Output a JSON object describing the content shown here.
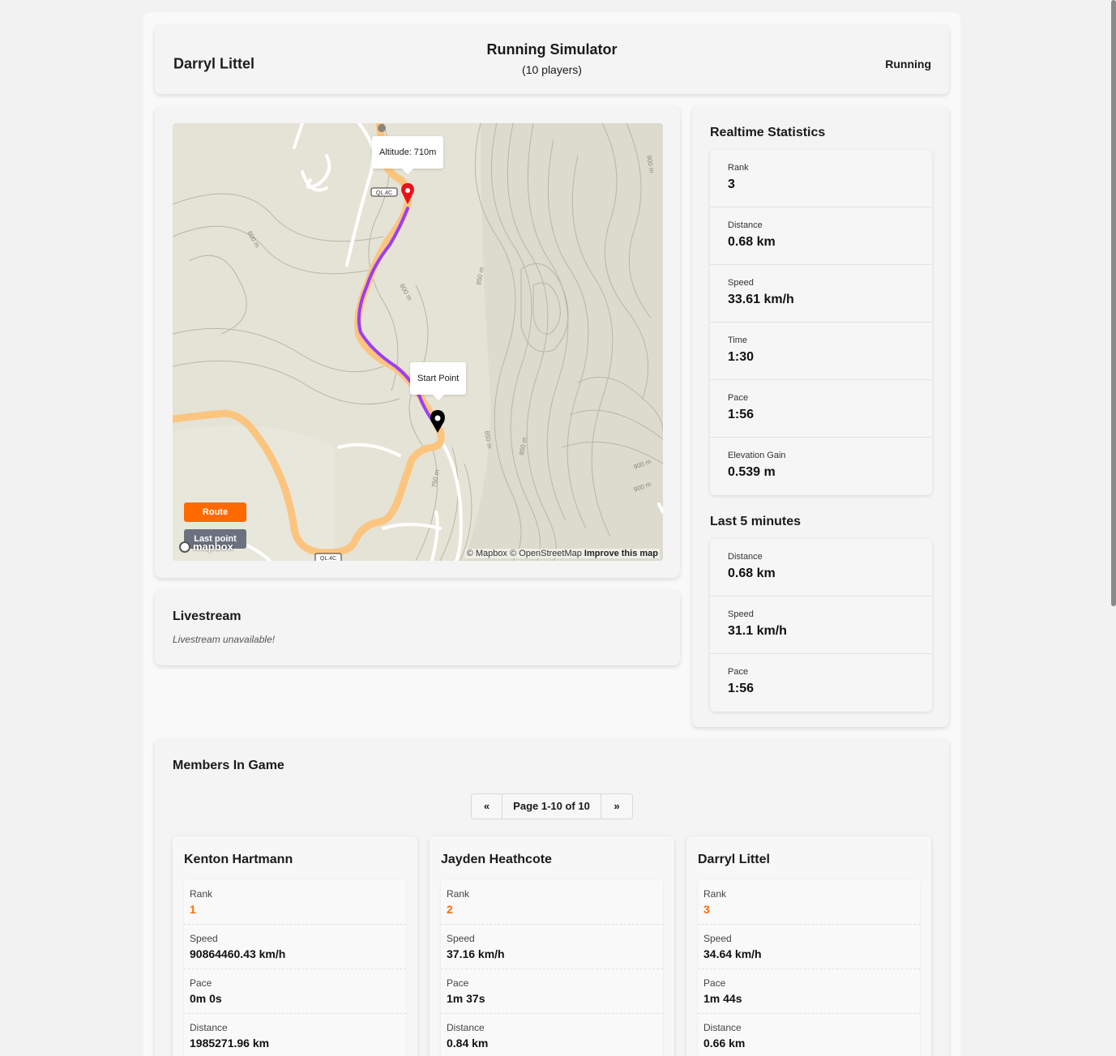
{
  "header": {
    "player_name": "Darryl Littel",
    "title": "Running Simulator",
    "subtitle": "(10 players)",
    "status": "Running"
  },
  "map": {
    "popup_altitude": "Altitude: 710m",
    "popup_start": "Start Point",
    "route_button": "Route",
    "last_point_button": "Last point",
    "logo_text": "mapbox",
    "attribution": "© Mapbox © OpenStreetMap",
    "improve_link": "Improve this map",
    "road_label": "QL.4C",
    "contour_labels": [
      "800 m",
      "900 m",
      "850 m",
      "800 m",
      "850 m",
      "850 m",
      "900 m",
      "750 m",
      "900 m"
    ],
    "colors": {
      "route": "#9b3ff2",
      "road": "#fbc57f",
      "marker_end": "#e8121b",
      "marker_start": "#000000"
    }
  },
  "livestream": {
    "title": "Livestream",
    "message": "Livestream unavailable!"
  },
  "realtime": {
    "title": "Realtime Statistics",
    "items": [
      {
        "label": "Rank",
        "value": "3"
      },
      {
        "label": "Distance",
        "value": "0.68 km"
      },
      {
        "label": "Speed",
        "value": "33.61 km/h"
      },
      {
        "label": "Time",
        "value": "1:30"
      },
      {
        "label": "Pace",
        "value": "1:56"
      },
      {
        "label": "Elevation Gain",
        "value": "0.539 m"
      }
    ]
  },
  "last5": {
    "title": "Last 5 minutes",
    "items": [
      {
        "label": "Distance",
        "value": "0.68 km"
      },
      {
        "label": "Speed",
        "value": "31.1 km/h"
      },
      {
        "label": "Pace",
        "value": "1:56"
      }
    ]
  },
  "members": {
    "title": "Members In Game",
    "pager": {
      "prev": "«",
      "label": "Page 1-10 of 10",
      "next": "»"
    },
    "labels": {
      "rank": "Rank",
      "speed": "Speed",
      "pace": "Pace",
      "distance": "Distance"
    },
    "list": [
      {
        "name": "Kenton Hartmann",
        "rank": "1",
        "speed": "90864460.43 km/h",
        "pace": "0m 0s",
        "distance": "1985271.96 km"
      },
      {
        "name": "Jayden Heathcote",
        "rank": "2",
        "speed": "37.16 km/h",
        "pace": "1m 37s",
        "distance": "0.84 km"
      },
      {
        "name": "Darryl Littel",
        "rank": "3",
        "speed": "34.64 km/h",
        "pace": "1m 44s",
        "distance": "0.66 km"
      }
    ]
  },
  "accent_color": "#ff6a00"
}
